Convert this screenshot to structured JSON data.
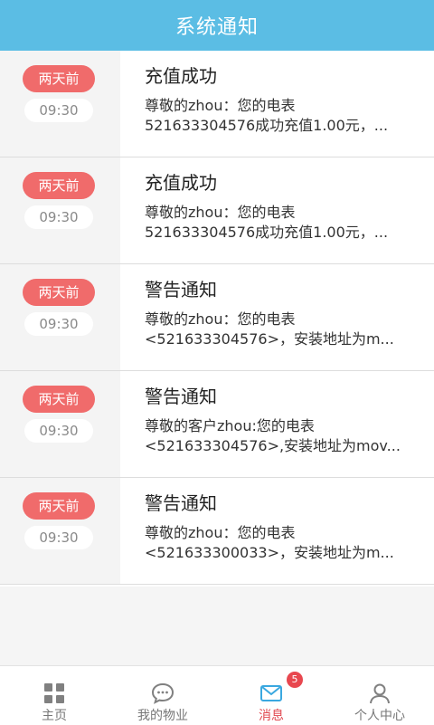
{
  "header": {
    "title": "系统通知"
  },
  "notifications": [
    {
      "day": "两天前",
      "time": "09:30",
      "title": "充值成功",
      "line1": "尊敬的zhou：您的电表",
      "line2": "521633304576成功充值1.00元，..."
    },
    {
      "day": "两天前",
      "time": "09:30",
      "title": "充值成功",
      "line1": "尊敬的zhou：您的电表",
      "line2": "521633304576成功充值1.00元，..."
    },
    {
      "day": "两天前",
      "time": "09:30",
      "title": "警告通知",
      "line1": "尊敬的zhou：您的电表",
      "line2": "<521633304576>，安装地址为m..."
    },
    {
      "day": "两天前",
      "time": "09:30",
      "title": "警告通知",
      "line1": "尊敬的客户zhou:您的电表",
      "line2": "<521633304576>,安装地址为mov..."
    },
    {
      "day": "两天前",
      "time": "09:30",
      "title": "警告通知",
      "line1": "尊敬的zhou：您的电表",
      "line2": "<521633300033>，安装地址为m..."
    }
  ],
  "tabbar": {
    "home_label": "主页",
    "property_label": "我的物业",
    "messages_label": "消息",
    "messages_badge": "5",
    "profile_label": "个人中心"
  },
  "colors": {
    "header": "#5bbde4",
    "day_badge": "#f06b6b",
    "active_tab": "#e0474f",
    "active_icon": "#3aa8e0"
  },
  "icons": {
    "home": "grid-icon",
    "property": "chat-bubble-icon",
    "messages": "envelope-icon",
    "profile": "person-icon"
  }
}
